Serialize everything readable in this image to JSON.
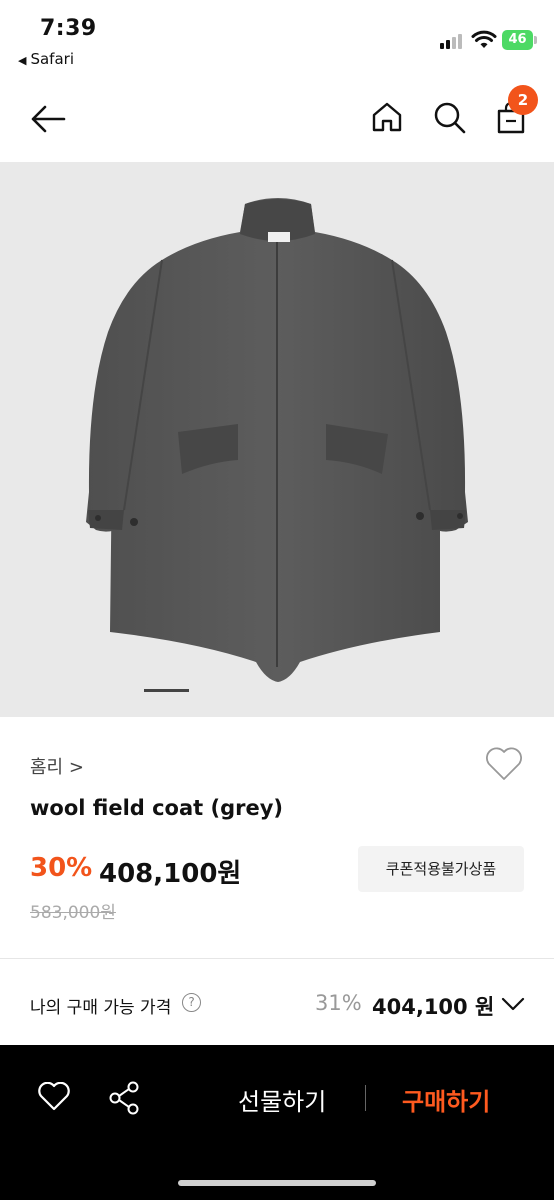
{
  "status_bar": {
    "time": "7:39",
    "back_app": "Safari",
    "battery_level": "46",
    "battery_color": "#4cd964"
  },
  "nav": {
    "back_icon": "arrow-left-icon",
    "home_icon": "home-icon",
    "search_icon": "search-icon",
    "cart_icon": "shopping-bag-icon",
    "cart_count": "2"
  },
  "product": {
    "brand": "홈리 >",
    "title": "wool field coat (grey)",
    "discount_rate": "30%",
    "price": "408,100원",
    "original_price": "583,000원",
    "coupon_label": "쿠폰적용불가상품",
    "image_page": 1
  },
  "my_price": {
    "label": "나의 구매 가능 가격",
    "help": "?",
    "discount_rate": "31%",
    "price": "404,100 원"
  },
  "bottom_bar": {
    "gift_label": "선물하기",
    "buy_label": "구매하기",
    "accent_color": "#ff5a1f"
  }
}
